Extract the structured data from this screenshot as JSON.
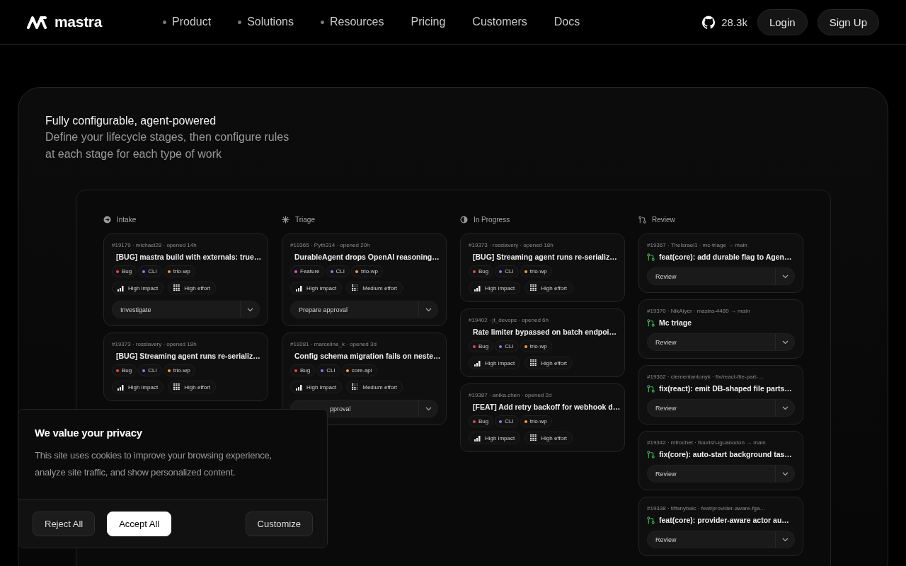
{
  "nav": {
    "logo": "mastra",
    "items": [
      {
        "label": "Product",
        "has_menu": true
      },
      {
        "label": "Solutions",
        "has_menu": true
      },
      {
        "label": "Resources",
        "has_menu": true
      },
      {
        "label": "Pricing",
        "has_menu": false
      },
      {
        "label": "Customers",
        "has_menu": false
      },
      {
        "label": "Docs",
        "has_menu": false
      }
    ],
    "stars": "28.3k",
    "login": "Login",
    "signup": "Sign Up"
  },
  "feature": {
    "title": "Fully configurable, agent-powered",
    "description": "Define your lifecycle stages, then configure rules\nat each stage for each type of work"
  },
  "board": {
    "columns": [
      {
        "title": "Intake",
        "kind": "intake",
        "cards": [
          {
            "meta": "#19179 · michael28 · opened 14h",
            "title": "[BUG] mastra build with externals: true…",
            "tags": [
              {
                "label": "Bug",
                "color": "#e5484d"
              },
              {
                "label": "CLI",
                "color": "#8e7cf0"
              },
              {
                "label": "trio-wp",
                "color": "#f0a23b"
              }
            ],
            "badges": [
              {
                "label": "High impact",
                "kind": "impact"
              },
              {
                "label": "High effort",
                "kind": "effort-full"
              }
            ],
            "action": "Investigate"
          },
          {
            "meta": "#19373 · rosslavery · opened 18h",
            "title": "[BUG] Streaming agent runs re-serializ…",
            "tags": [
              {
                "label": "Bug",
                "color": "#e5484d"
              },
              {
                "label": "CLI",
                "color": "#8e7cf0"
              },
              {
                "label": "trio-wp",
                "color": "#f0a23b"
              }
            ],
            "badges": [
              {
                "label": "High impact",
                "kind": "impact"
              },
              {
                "label": "High effort",
                "kind": "effort-full"
              }
            ]
          }
        ]
      },
      {
        "title": "Triage",
        "kind": "triage",
        "cards": [
          {
            "meta": "#19365 · Pyth314 · opened 20h",
            "title": "DurableAgent drops OpenAI reasoning…",
            "tags": [
              {
                "label": "Feature",
                "color": "#e055b8"
              },
              {
                "label": "CLI",
                "color": "#8e7cf0"
              },
              {
                "label": "trio-wp",
                "color": "#f0a23b"
              }
            ],
            "badges": [
              {
                "label": "High impact",
                "kind": "impact"
              },
              {
                "label": "Medium effort",
                "kind": "effort-partial"
              }
            ],
            "action": "Prepare approval"
          },
          {
            "meta": "#19281 · marceline_k · opened 3d",
            "title": "Config schema migration fails on neste…",
            "tags": [
              {
                "label": "Bug",
                "color": "#e5484d"
              },
              {
                "label": "CLI",
                "color": "#8e7cf0"
              },
              {
                "label": "core-api",
                "color": "#f0a23b"
              }
            ],
            "badges": [
              {
                "label": "High impact",
                "kind": "impact"
              },
              {
                "label": "Medium effort",
                "kind": "effort-partial"
              }
            ],
            "action": "pproval",
            "action_covered": true
          }
        ]
      },
      {
        "title": "In Progress",
        "kind": "progress",
        "cards": [
          {
            "meta": "#19373 · rosslavery · opened 18h",
            "title": "[BUG] Streaming agent runs re-serializ…",
            "tags": [
              {
                "label": "Bug",
                "color": "#e5484d"
              },
              {
                "label": "CLI",
                "color": "#8e7cf0"
              },
              {
                "label": "trio-wp",
                "color": "#f0a23b"
              }
            ],
            "badges": [
              {
                "label": "High impact",
                "kind": "impact"
              },
              {
                "label": "High effort",
                "kind": "effort-full"
              }
            ]
          },
          {
            "meta": "#19402 · jt_devops · opened 6h",
            "title": "Rate limiter bypassed on batch endpoi…",
            "tags": [
              {
                "label": "Bug",
                "color": "#e5484d"
              },
              {
                "label": "CLI",
                "color": "#8e7cf0"
              },
              {
                "label": "trio-wp",
                "color": "#f0a23b"
              }
            ],
            "badges": [
              {
                "label": "High impact",
                "kind": "impact"
              },
              {
                "label": "High effort",
                "kind": "effort-full"
              }
            ]
          },
          {
            "meta": "#19387 · anika.chen · opened 2d",
            "title": "[FEAT] Add retry backoff for webhook d…",
            "tags": [
              {
                "label": "Bug",
                "color": "#e5484d"
              },
              {
                "label": "CLI",
                "color": "#8e7cf0"
              },
              {
                "label": "trio-wp",
                "color": "#f0a23b"
              }
            ],
            "badges": [
              {
                "label": "High impact",
                "kind": "impact"
              },
              {
                "label": "High effort",
                "kind": "effort-full"
              }
            ]
          }
        ]
      },
      {
        "title": "Review",
        "kind": "review",
        "cards": [
          {
            "meta": "#19367 · TheIsrael1 · mc-triage → main",
            "title": "feat(core): add durable flag to Agen…",
            "action": "Review"
          },
          {
            "meta": "#19370 · NikAiyer · mastra-4480 → main",
            "title": "Mc triage",
            "action": "Review"
          },
          {
            "meta": "#19362 · clementantonyk · fix/react-file-part-…",
            "title": "fix(react): emit DB-shaped file parts…",
            "action": "Review"
          },
          {
            "meta": "#19342 · mfrochet · flourish-iguanodon → main",
            "title": "fix(core): auto-start background tas…",
            "action": "Review"
          },
          {
            "meta": "#19338 · tiffanybalc · feat/provider-aware-fga…",
            "title": "feat(core): provider-aware actor au…",
            "action": "Review"
          }
        ]
      }
    ]
  },
  "cookie": {
    "title": "We value your privacy",
    "text": "This site uses cookies to improve your browsing experience, analyze site traffic, and show personalized content.",
    "reject": "Reject All",
    "accept": "Accept All",
    "customize": "Customize"
  }
}
